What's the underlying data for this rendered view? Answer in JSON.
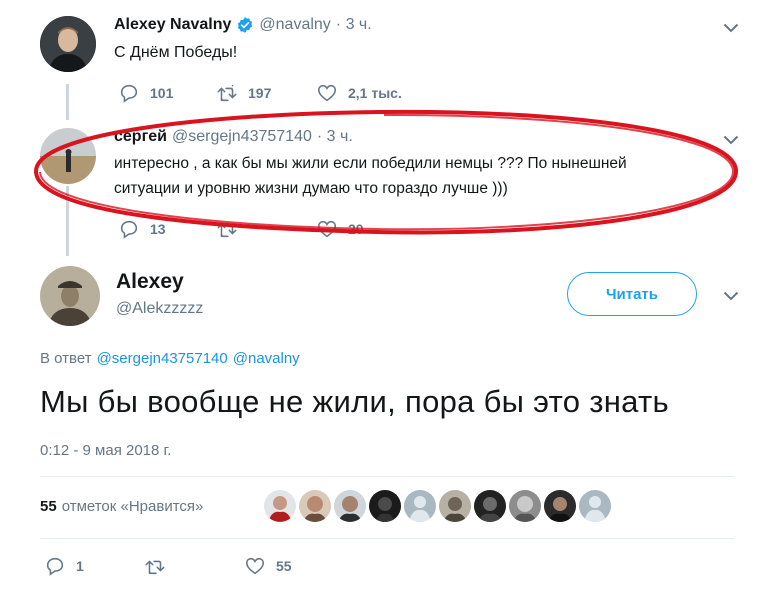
{
  "tweet1": {
    "name": "Alexey Navalny",
    "handle": "@navalny",
    "time": "· 3 ч.",
    "text": "С Днём Победы!",
    "replies": "101",
    "retweets": "197",
    "likes": "2,1 тыс."
  },
  "tweet2": {
    "name": "сергей",
    "handle": "@sergejn43757140",
    "time": "· 3 ч.",
    "text_line1": "интересно , а как бы мы жили если победили немцы ??? По нынешней",
    "text_line2": "ситуации и уровню жизни думаю что гораздо лучше )))",
    "replies": "13",
    "likes": "20"
  },
  "main_tweet": {
    "name": "Alexey",
    "handle": "@Alekzzzzz",
    "follow_label": "Читать",
    "reply_prefix": "В ответ",
    "reply_to_1": "@sergejn43757140",
    "reply_to_2": "@navalny",
    "text": "Мы бы вообще не жили, пора бы это знать",
    "timestamp": "0:12 - 9 мая 2018 г.",
    "likes_count": "55",
    "likes_label": "отметок «Нравится»",
    "replies": "1",
    "like_action_count": "55"
  },
  "colors": {
    "accent": "#1da1f2",
    "link": "#1b95e0",
    "muted": "#657786",
    "highlight": "#d9141f",
    "verified": "#1da1f2"
  },
  "icons": [
    "verified-badge-icon",
    "reply-icon",
    "retweet-icon",
    "like-icon",
    "chevron-down-icon"
  ]
}
